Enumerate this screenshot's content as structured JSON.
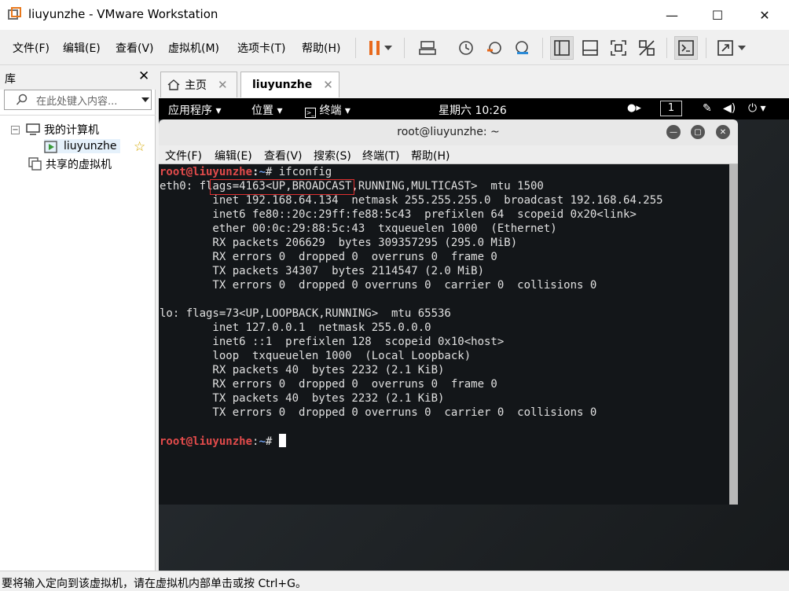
{
  "window": {
    "title": "liuyunzhe - VMware Workstation"
  },
  "menu": [
    "文件(F)",
    "编辑(E)",
    "查看(V)",
    "虚拟机(M)",
    "选项卡(T)",
    "帮助(H)"
  ],
  "library": {
    "title": "库",
    "search_placeholder": "在此处键入内容...",
    "tree": {
      "my_computer": "我的计算机",
      "vm": "liuyunzhe",
      "shared": "共享的虚拟机"
    }
  },
  "tabs": [
    {
      "label": "主页"
    },
    {
      "label": "liuyunzhe"
    }
  ],
  "gnome": {
    "apps": "应用程序",
    "places": "位置",
    "terminal": "终端",
    "clock": "星期六 10:26",
    "workspace": "1"
  },
  "terminal": {
    "title": "root@liuyunzhe: ~",
    "menu": [
      "文件(F)",
      "编辑(E)",
      "查看(V)",
      "搜索(S)",
      "终端(T)",
      "帮助(H)"
    ],
    "prompt_user": "root@liuyunzhe",
    "prompt_sep": ":",
    "prompt_path": "~",
    "prompt_char": "#",
    "command": " ifconfig",
    "lines": [
      "eth0: flags=4163<UP,BROADCAST,RUNNING,MULTICAST>  mtu 1500",
      "        inet 192.168.64.134  netmask 255.255.255.0  broadcast 192.168.64.255",
      "        inet6 fe80::20c:29ff:fe88:5c43  prefixlen 64  scopeid 0x20<link>",
      "        ether 00:0c:29:88:5c:43  txqueuelen 1000  (Ethernet)",
      "        RX packets 206629  bytes 309357295 (295.0 MiB)",
      "        RX errors 0  dropped 0  overruns 0  frame 0",
      "        TX packets 34307  bytes 2114547 (2.0 MiB)",
      "        TX errors 0  dropped 0 overruns 0  carrier 0  collisions 0",
      "",
      "lo: flags=73<UP,LOOPBACK,RUNNING>  mtu 65536",
      "        inet 127.0.0.1  netmask 255.0.0.0",
      "        inet6 ::1  prefixlen 128  scopeid 0x10<host>",
      "        loop  txqueuelen 1000  (Local Loopback)",
      "        RX packets 40  bytes 2232 (2.1 KiB)",
      "        RX errors 0  dropped 0  overruns 0  frame 0",
      "        TX packets 40  bytes 2232 (2.1 KiB)",
      "        TX errors 0  dropped 0 overruns 0  carrier 0  collisions 0",
      ""
    ]
  },
  "status": {
    "text": "要将输入定向到该虚拟机，请在虚拟机内部单击或按 Ctrl+G。"
  },
  "colors": {
    "accent_pause": "#e8691c",
    "prompt_red": "#e24b4b",
    "prompt_blue": "#6c9be6",
    "highlight": "#e03030"
  }
}
